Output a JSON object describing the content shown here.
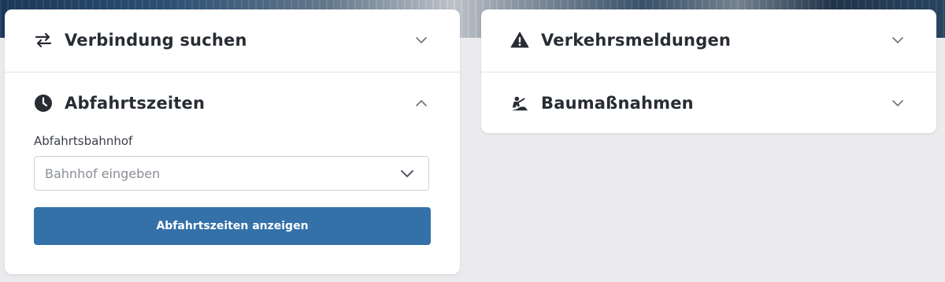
{
  "colors": {
    "accent": "#3471a8",
    "title_text": "#282d33",
    "card_bg": "#ffffff",
    "page_bg": "#ebebed"
  },
  "left_card": {
    "connection": {
      "icon": "swap-arrows-icon",
      "title": "Verbindung suchen",
      "expanded": false
    },
    "departures": {
      "icon": "clock-icon",
      "title": "Abfahrtszeiten",
      "expanded": true,
      "station_label": "Abfahrtsbahnhof",
      "station_placeholder": "Bahnhof eingeben",
      "submit_label": "Abfahrtszeiten anzeigen"
    }
  },
  "right_card": {
    "traffic": {
      "icon": "warning-icon",
      "title": "Verkehrsmeldungen",
      "expanded": false
    },
    "construction": {
      "icon": "construction-worker-icon",
      "title": "Baumaßnahmen",
      "expanded": false
    }
  }
}
